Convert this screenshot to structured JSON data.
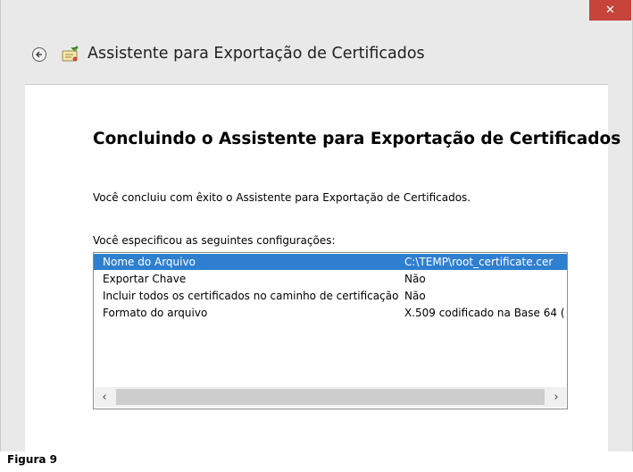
{
  "window": {
    "title": "Assistente para Exportação de Certificados",
    "close_label": "✕"
  },
  "wizard": {
    "heading": "Concluindo o Assistente para Exportação de Certificados",
    "completed_text": "Você concluiu com êxito o Assistente para Exportação de Certificados.",
    "settings_label": "Você especificou as seguintes configurações:",
    "settings": [
      {
        "key": "Nome do Arquivo",
        "value": "C:\\TEMP\\root_certificate.cer",
        "selected": true
      },
      {
        "key": "Exportar Chave",
        "value": "Não",
        "selected": false
      },
      {
        "key": "Incluir todos os certificados no caminho de certificação",
        "value": "Não",
        "selected": false
      },
      {
        "key": "Formato do arquivo",
        "value": "X.509 codificado na Base 64 (",
        "selected": false
      }
    ]
  },
  "scrollbar": {
    "left_arrow": "‹",
    "right_arrow": "›"
  },
  "caption": "Figura 9",
  "colors": {
    "selection": "#2f7fd1",
    "close_button": "#c7443b",
    "frame": "#e9e9e9"
  },
  "icons": {
    "back": "back-arrow-icon",
    "certificate": "certificate-icon",
    "close": "close-icon"
  }
}
